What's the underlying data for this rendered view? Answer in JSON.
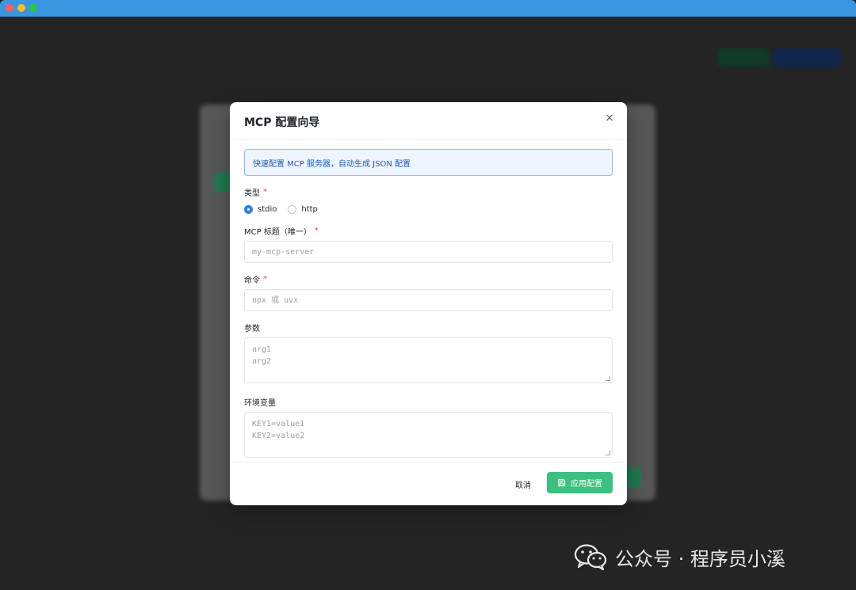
{
  "modal": {
    "title": "MCP 配置向导",
    "close_glyph": "×",
    "info": "快速配置 MCP 服务器，自动生成 JSON 配置",
    "type_label": "类型",
    "type_options": [
      "stdio",
      "http"
    ],
    "type_selected": "stdio",
    "title_label": "MCP 标题（唯一）",
    "title_placeholder": "my-mcp-server",
    "command_label": "命令",
    "command_placeholder": "npx 或 uvx",
    "args_label": "参数",
    "args_placeholder": [
      "arg1",
      "arg2"
    ],
    "env_label": "环境变量",
    "env_placeholder": [
      "KEY1=value1",
      "KEY2=value2"
    ],
    "required_mark": "*",
    "cancel_label": "取消",
    "apply_label": "应用配置"
  },
  "watermark": {
    "text": "公众号 · 程序员小溪",
    "icon": "wechat-icon"
  },
  "colors": {
    "titlebar": "#3a96de",
    "primary_button": "#3cbf7f",
    "info_border": "#8fb9ec",
    "radio_checked": "#2f7ef0",
    "required": "#e5484d"
  }
}
